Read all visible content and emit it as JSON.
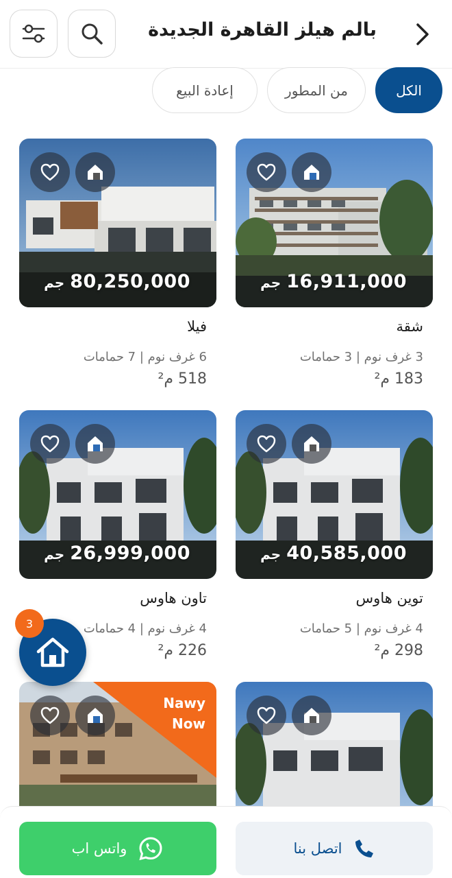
{
  "header": {
    "title": "بالم هيلز القاهرة الجديدة",
    "back_icon": "chevron-right-icon",
    "search_icon": "search-icon",
    "filter_icon": "filter-sliders-icon"
  },
  "tabs": [
    {
      "label": "الكل",
      "active": true
    },
    {
      "label": "من المطور",
      "active": false
    },
    {
      "label": "إعادة البيع",
      "active": false
    }
  ],
  "listings": [
    {
      "price": "16,911,000",
      "currency": "جم",
      "type": "شقة",
      "rooms": "3 غرف نوم | 3 حمامات",
      "area": "183 م²"
    },
    {
      "price": "80,250,000",
      "currency": "جم",
      "type": "فيلا",
      "rooms": "6 غرف نوم | 7 حمامات",
      "area": "518 م²"
    },
    {
      "price": "40,585,000",
      "currency": "جم",
      "type": "توين هاوس",
      "rooms": "4 غرف نوم | 5 حمامات",
      "area": "298 م²"
    },
    {
      "price": "26,999,000",
      "currency": "جم",
      "type": "تاون هاوس",
      "rooms": "4 غرف نوم | 4 حمامات",
      "area": "226 م²"
    },
    {
      "price": "",
      "currency": "",
      "type": "",
      "rooms": "",
      "area": ""
    },
    {
      "price": "",
      "currency": "",
      "type": "",
      "rooms": "",
      "area": "",
      "ribbon_line1": "Nawy",
      "ribbon_line2": "Now"
    }
  ],
  "fab": {
    "badge": "3",
    "icon": "home-icon"
  },
  "bottom_bar": {
    "call_label": "اتصل بنا",
    "whatsapp_label": "واتس اب",
    "call_icon": "phone-icon",
    "whatsapp_icon": "whatsapp-icon"
  },
  "colors": {
    "primary": "#0a4f8f",
    "accent": "#f26a1b",
    "whatsapp": "#3ecf6b"
  }
}
